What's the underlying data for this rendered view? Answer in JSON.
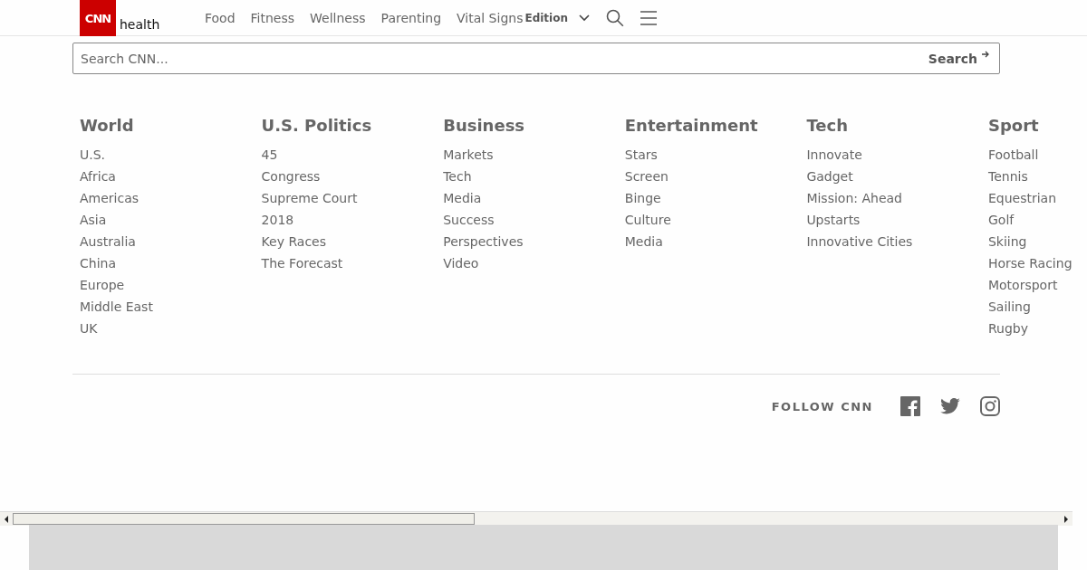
{
  "header": {
    "logo": "CNN",
    "section": "health",
    "nav": [
      "Food",
      "Fitness",
      "Wellness",
      "Parenting",
      "Vital Signs"
    ],
    "edition": "Edition"
  },
  "search": {
    "placeholder": "Search CNN...",
    "button": "Search"
  },
  "columns": [
    {
      "title": "World",
      "links": [
        "U.S.",
        "Africa",
        "Americas",
        "Asia",
        "Australia",
        "China",
        "Europe",
        "Middle East",
        "UK"
      ]
    },
    {
      "title": "U.S. Politics",
      "links": [
        "45",
        "Congress",
        "Supreme Court",
        "2018",
        "Key Races",
        "The Forecast"
      ]
    },
    {
      "title": "Business",
      "links": [
        "Markets",
        "Tech",
        "Media",
        "Success",
        "Perspectives",
        "Video"
      ]
    },
    {
      "title": "Entertainment",
      "links": [
        "Stars",
        "Screen",
        "Binge",
        "Culture",
        "Media"
      ]
    },
    {
      "title": "Tech",
      "links": [
        "Innovate",
        "Gadget",
        "Mission: Ahead",
        "Upstarts",
        "Innovative Cities"
      ]
    },
    {
      "title": "Sport",
      "links": [
        "Football",
        "Tennis",
        "Equestrian",
        "Golf",
        "Skiing",
        "Horse Racing",
        "Motorsport",
        "Sailing",
        "Rugby"
      ]
    }
  ],
  "follow": {
    "label": "FOLLOW CNN"
  }
}
